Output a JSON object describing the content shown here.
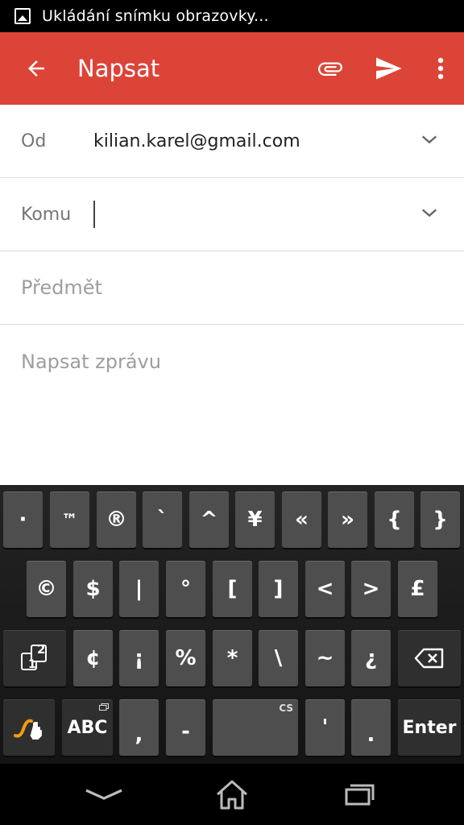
{
  "status_bar": {
    "notification_text": "Ukládání snímku obrazovky..."
  },
  "app_bar": {
    "title": "Napsat",
    "accent_color": "#db4437"
  },
  "compose": {
    "from_label": "Od",
    "from_value": "kilian.karel@gmail.com",
    "to_label": "Komu",
    "to_value": "",
    "subject_placeholder": "Předmět",
    "body_placeholder": "Napsat zprávu"
  },
  "keyboard": {
    "row1": [
      "·",
      "™",
      "®",
      "`",
      "^",
      "¥",
      "«",
      "»",
      "{",
      "}"
    ],
    "row2": [
      "©",
      "$",
      "|",
      "°",
      "[",
      "]",
      "<",
      ">",
      "£"
    ],
    "row3": [
      "¢",
      "¡",
      "%",
      "*",
      "\\",
      "~",
      "¿"
    ],
    "row4": {
      "abc_label": "ABC",
      "comma": ",",
      "dash": "-",
      "space_lang": "CS",
      "apostrophe": "'",
      "period": ".",
      "enter_label": "Enter"
    },
    "mode_key_sub": "2",
    "mode_key_main": "1"
  }
}
